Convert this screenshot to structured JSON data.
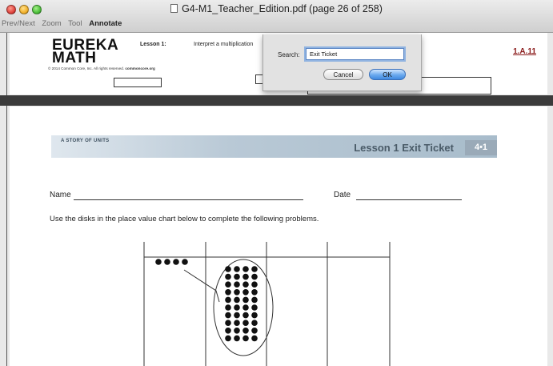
{
  "window": {
    "title": "G4-M1_Teacher_Edition.pdf (page 26 of 258)"
  },
  "toolbar": {
    "items": [
      "Prev/Next",
      "Zoom",
      "Tool",
      "Annotate"
    ]
  },
  "page_header": {
    "logo_line1": "EUREKA",
    "logo_line2": "MATH",
    "copyright_text": "© 2014 Common Core, Inc. All rights reserved. ",
    "copyright_site": "commoncore.org",
    "lesson_label": "Lesson 1:",
    "lesson_description": "Interpret a multiplication",
    "standard_code": "1.A.11"
  },
  "search_dialog": {
    "label": "Search:",
    "value": "Exit Ticket",
    "cancel_label": "Cancel",
    "ok_label": "OK"
  },
  "document": {
    "banner_left": "A STORY OF UNITS",
    "banner_title": "Lesson 1 Exit Ticket",
    "grade_tag": "4•1",
    "name_label": "Name",
    "date_label": "Date",
    "instructions": "Use the disks in the place value chart below to complete the following problems."
  },
  "place_value_chart": {
    "small_disk_count": 4,
    "big_group_columns": 4,
    "big_group_rows": 10
  }
}
